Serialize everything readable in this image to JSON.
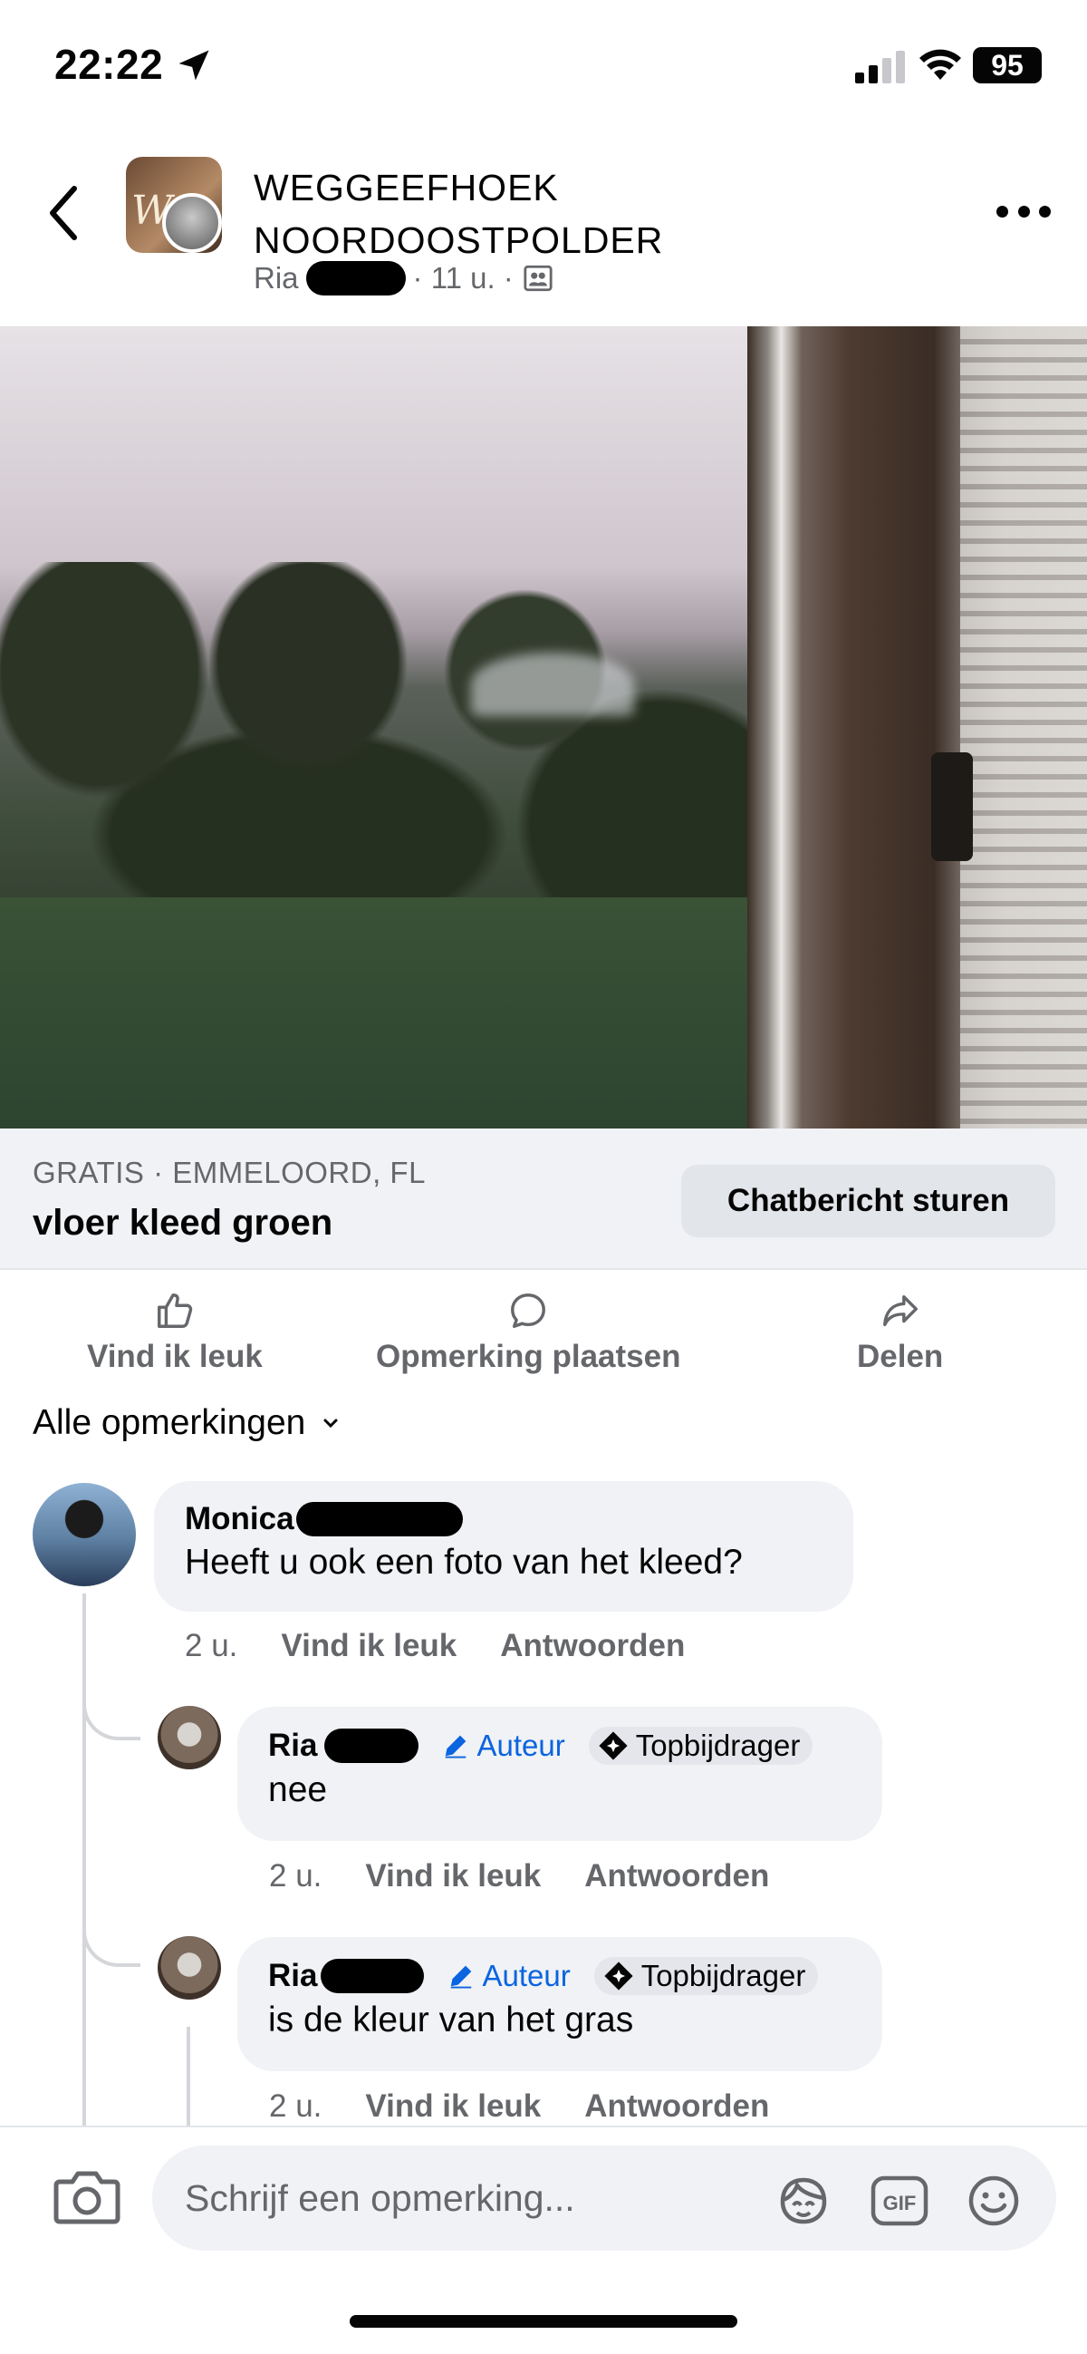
{
  "status_bar": {
    "time": "22:22",
    "battery": "95"
  },
  "header": {
    "group_name": "WEGGEEFHOEK NOORDOOSTPOLDER",
    "author_first": "Ria",
    "time_ago": "· 11 u. ·"
  },
  "listing": {
    "meta": "GRATIS · EMMELOORD, FL",
    "title": "vloer kleed groen",
    "chat_button": "Chatbericht sturen"
  },
  "actions": {
    "like": "Vind ik leuk",
    "comment": "Opmerking plaatsen",
    "share": "Delen"
  },
  "comments_filter": "Alle opmerkingen",
  "comments": [
    {
      "author_first": "Monica",
      "text": "Heeft u ook een foto van het kleed?",
      "time": "2 u.",
      "like": "Vind ik leuk",
      "reply": "Antwoorden"
    },
    {
      "author_first": "Ria",
      "badge_author": "Auteur",
      "badge_top": "Topbijdrager",
      "text": "nee",
      "time": "2 u.",
      "like": "Vind ik leuk",
      "reply": "Antwoorden"
    },
    {
      "author_first": "Ria",
      "badge_author": "Auteur",
      "badge_top": "Topbijdrager",
      "text": "is de kleur van het gras",
      "time": "2 u.",
      "like": "Vind ik leuk",
      "reply": "Antwoorden"
    }
  ],
  "composer": {
    "placeholder": "Schrijf een opmerking...",
    "gif_label": "GIF"
  },
  "icons": {
    "back": "chevron-left-icon",
    "more": "more-dots-icon",
    "like": "thumbs-up-icon",
    "comment": "comment-bubble-icon",
    "share": "share-arrow-icon",
    "camera": "camera-icon",
    "avatar_sticker": "avatar-sticker-icon",
    "gif": "gif-icon",
    "emoji": "emoji-icon"
  },
  "colors": {
    "accent_blue": "#0b64e0",
    "secondary_text": "#65676b",
    "bubble_bg": "#f0f2f5"
  }
}
